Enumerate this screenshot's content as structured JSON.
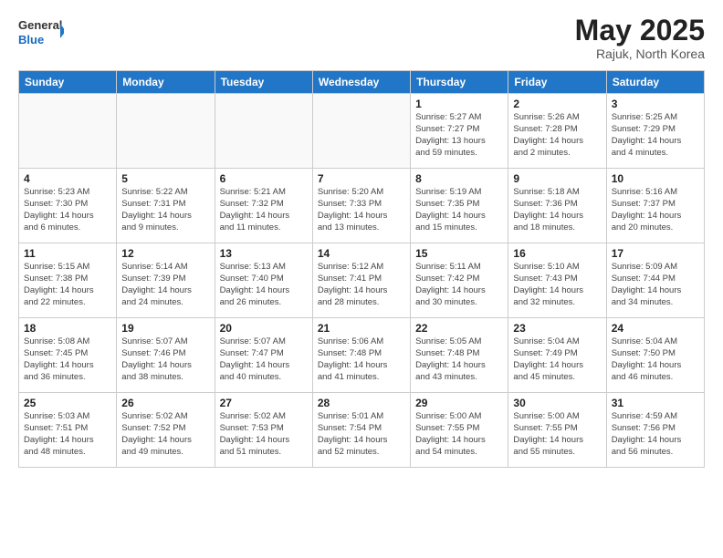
{
  "header": {
    "logo_general": "General",
    "logo_blue": "Blue",
    "month_title": "May 2025",
    "location": "Rajuk, North Korea"
  },
  "weekdays": [
    "Sunday",
    "Monday",
    "Tuesday",
    "Wednesday",
    "Thursday",
    "Friday",
    "Saturday"
  ],
  "weeks": [
    [
      {
        "day": "",
        "info": ""
      },
      {
        "day": "",
        "info": ""
      },
      {
        "day": "",
        "info": ""
      },
      {
        "day": "",
        "info": ""
      },
      {
        "day": "1",
        "info": "Sunrise: 5:27 AM\nSunset: 7:27 PM\nDaylight: 13 hours\nand 59 minutes."
      },
      {
        "day": "2",
        "info": "Sunrise: 5:26 AM\nSunset: 7:28 PM\nDaylight: 14 hours\nand 2 minutes."
      },
      {
        "day": "3",
        "info": "Sunrise: 5:25 AM\nSunset: 7:29 PM\nDaylight: 14 hours\nand 4 minutes."
      }
    ],
    [
      {
        "day": "4",
        "info": "Sunrise: 5:23 AM\nSunset: 7:30 PM\nDaylight: 14 hours\nand 6 minutes."
      },
      {
        "day": "5",
        "info": "Sunrise: 5:22 AM\nSunset: 7:31 PM\nDaylight: 14 hours\nand 9 minutes."
      },
      {
        "day": "6",
        "info": "Sunrise: 5:21 AM\nSunset: 7:32 PM\nDaylight: 14 hours\nand 11 minutes."
      },
      {
        "day": "7",
        "info": "Sunrise: 5:20 AM\nSunset: 7:33 PM\nDaylight: 14 hours\nand 13 minutes."
      },
      {
        "day": "8",
        "info": "Sunrise: 5:19 AM\nSunset: 7:35 PM\nDaylight: 14 hours\nand 15 minutes."
      },
      {
        "day": "9",
        "info": "Sunrise: 5:18 AM\nSunset: 7:36 PM\nDaylight: 14 hours\nand 18 minutes."
      },
      {
        "day": "10",
        "info": "Sunrise: 5:16 AM\nSunset: 7:37 PM\nDaylight: 14 hours\nand 20 minutes."
      }
    ],
    [
      {
        "day": "11",
        "info": "Sunrise: 5:15 AM\nSunset: 7:38 PM\nDaylight: 14 hours\nand 22 minutes."
      },
      {
        "day": "12",
        "info": "Sunrise: 5:14 AM\nSunset: 7:39 PM\nDaylight: 14 hours\nand 24 minutes."
      },
      {
        "day": "13",
        "info": "Sunrise: 5:13 AM\nSunset: 7:40 PM\nDaylight: 14 hours\nand 26 minutes."
      },
      {
        "day": "14",
        "info": "Sunrise: 5:12 AM\nSunset: 7:41 PM\nDaylight: 14 hours\nand 28 minutes."
      },
      {
        "day": "15",
        "info": "Sunrise: 5:11 AM\nSunset: 7:42 PM\nDaylight: 14 hours\nand 30 minutes."
      },
      {
        "day": "16",
        "info": "Sunrise: 5:10 AM\nSunset: 7:43 PM\nDaylight: 14 hours\nand 32 minutes."
      },
      {
        "day": "17",
        "info": "Sunrise: 5:09 AM\nSunset: 7:44 PM\nDaylight: 14 hours\nand 34 minutes."
      }
    ],
    [
      {
        "day": "18",
        "info": "Sunrise: 5:08 AM\nSunset: 7:45 PM\nDaylight: 14 hours\nand 36 minutes."
      },
      {
        "day": "19",
        "info": "Sunrise: 5:07 AM\nSunset: 7:46 PM\nDaylight: 14 hours\nand 38 minutes."
      },
      {
        "day": "20",
        "info": "Sunrise: 5:07 AM\nSunset: 7:47 PM\nDaylight: 14 hours\nand 40 minutes."
      },
      {
        "day": "21",
        "info": "Sunrise: 5:06 AM\nSunset: 7:48 PM\nDaylight: 14 hours\nand 41 minutes."
      },
      {
        "day": "22",
        "info": "Sunrise: 5:05 AM\nSunset: 7:48 PM\nDaylight: 14 hours\nand 43 minutes."
      },
      {
        "day": "23",
        "info": "Sunrise: 5:04 AM\nSunset: 7:49 PM\nDaylight: 14 hours\nand 45 minutes."
      },
      {
        "day": "24",
        "info": "Sunrise: 5:04 AM\nSunset: 7:50 PM\nDaylight: 14 hours\nand 46 minutes."
      }
    ],
    [
      {
        "day": "25",
        "info": "Sunrise: 5:03 AM\nSunset: 7:51 PM\nDaylight: 14 hours\nand 48 minutes."
      },
      {
        "day": "26",
        "info": "Sunrise: 5:02 AM\nSunset: 7:52 PM\nDaylight: 14 hours\nand 49 minutes."
      },
      {
        "day": "27",
        "info": "Sunrise: 5:02 AM\nSunset: 7:53 PM\nDaylight: 14 hours\nand 51 minutes."
      },
      {
        "day": "28",
        "info": "Sunrise: 5:01 AM\nSunset: 7:54 PM\nDaylight: 14 hours\nand 52 minutes."
      },
      {
        "day": "29",
        "info": "Sunrise: 5:00 AM\nSunset: 7:55 PM\nDaylight: 14 hours\nand 54 minutes."
      },
      {
        "day": "30",
        "info": "Sunrise: 5:00 AM\nSunset: 7:55 PM\nDaylight: 14 hours\nand 55 minutes."
      },
      {
        "day": "31",
        "info": "Sunrise: 4:59 AM\nSunset: 7:56 PM\nDaylight: 14 hours\nand 56 minutes."
      }
    ]
  ]
}
